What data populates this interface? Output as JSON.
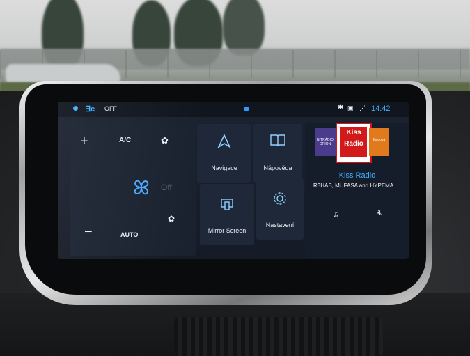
{
  "status_bar": {
    "temp_icon": "seat-heat-icon",
    "ac_state": "OFF",
    "time": "14:42",
    "icons": [
      "bluetooth-icon",
      "car-icon",
      "signal-icon"
    ]
  },
  "climate": {
    "plus_label": "+",
    "minus_label": "−",
    "ac_label": "A/C",
    "off_label": "Off",
    "auto_label": "AUTO"
  },
  "tiles": [
    {
      "label": "Navigace",
      "icon": "navigation-icon"
    },
    {
      "label": "Nápověda",
      "icon": "book-icon"
    },
    {
      "label": "Mirror Screen",
      "icon": "phone-mirror-icon"
    },
    {
      "label": "Nastavení",
      "icon": "gear-icon"
    }
  ],
  "radio": {
    "logo_left": "NITRÁDIO ORION",
    "logo_mid": "Kiss Radio",
    "logo_right": "Jiskrová",
    "station": "Kiss Radio",
    "track": "R3HAB, MUFASA and HYPEMA..."
  },
  "colors": {
    "accent": "#3fb1ff",
    "tile_bg": "#1f2838"
  }
}
